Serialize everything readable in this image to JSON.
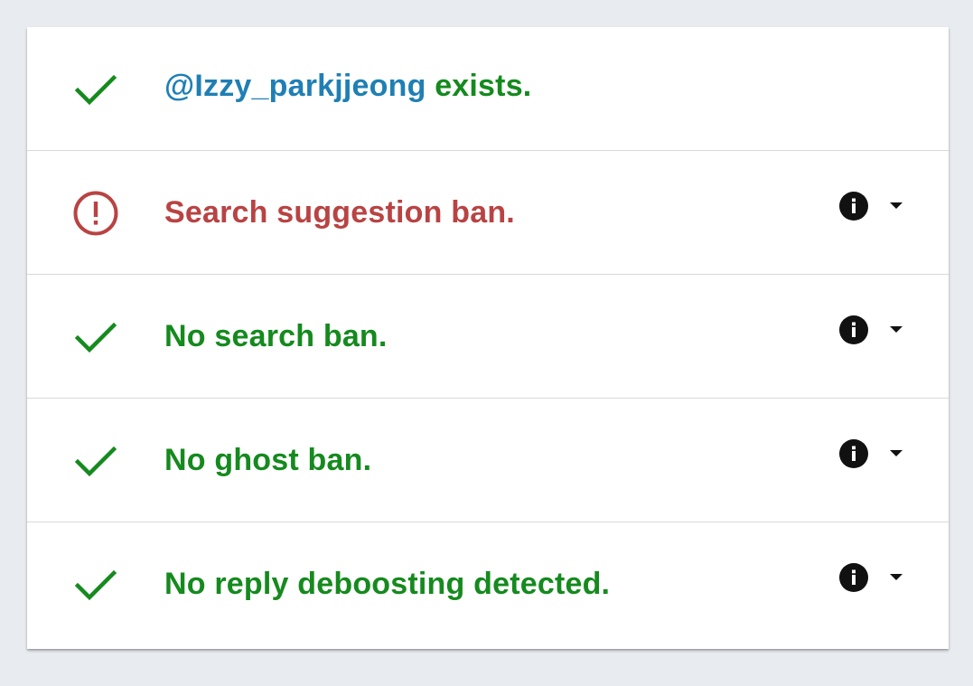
{
  "colors": {
    "ok": "#158a1e",
    "bad": "#b94343",
    "handle": "#1f7fb4",
    "background": "#e8ecf0",
    "card": "#ffffff"
  },
  "rows": [
    {
      "status": "ok",
      "icon": "check-icon",
      "handle": "@Izzy_parkjjeong",
      "text": " exists.",
      "has_details": false
    },
    {
      "status": "bad",
      "icon": "alert-circle-icon",
      "text": "Search suggestion ban.",
      "has_details": true,
      "info_icon": "info-icon",
      "toggle_icon": "caret-down-icon"
    },
    {
      "status": "ok",
      "icon": "check-icon",
      "text": "No search ban.",
      "has_details": true,
      "info_icon": "info-icon",
      "toggle_icon": "caret-down-icon"
    },
    {
      "status": "ok",
      "icon": "check-icon",
      "text": "No ghost ban.",
      "has_details": true,
      "info_icon": "info-icon",
      "toggle_icon": "caret-down-icon"
    },
    {
      "status": "ok",
      "icon": "check-icon",
      "text": "No reply deboosting detected.",
      "has_details": true,
      "info_icon": "info-icon",
      "toggle_icon": "caret-down-icon"
    }
  ]
}
